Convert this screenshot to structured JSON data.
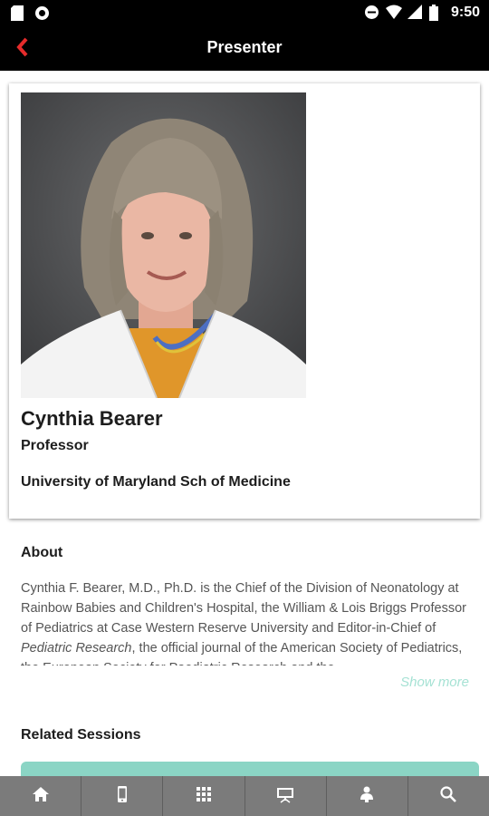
{
  "status_bar": {
    "time": "9:50"
  },
  "header": {
    "title": "Presenter"
  },
  "presenter": {
    "name": "Cynthia Bearer",
    "role": "Professor",
    "organization": "University of Maryland Sch of Medicine"
  },
  "about": {
    "heading": "About",
    "text_before": "Cynthia F. Bearer, M.D., Ph.D. is the Chief of the Division of Neonatology at Rainbow Babies and Children's Hospital, the William & Lois Briggs Professor of Pediatrics at Case Western Reserve University and Editor-in-Chief of ",
    "text_italic": "Pediatric Research",
    "text_after": ", the official journal of the American Society of Pediatrics, the European Society for Paediatric Research and the",
    "show_more_label": "Show more"
  },
  "related": {
    "heading": "Related Sessions"
  },
  "bottom_nav": {
    "items": [
      "home-icon",
      "mobile-icon",
      "grid-icon",
      "presentation-icon",
      "speaker-icon",
      "search-icon"
    ]
  },
  "colors": {
    "accent_red": "#e52b2b",
    "teal": "#8bd5c5",
    "show_more": "#a6e2d4",
    "nav_bg": "#7b7b7b"
  }
}
